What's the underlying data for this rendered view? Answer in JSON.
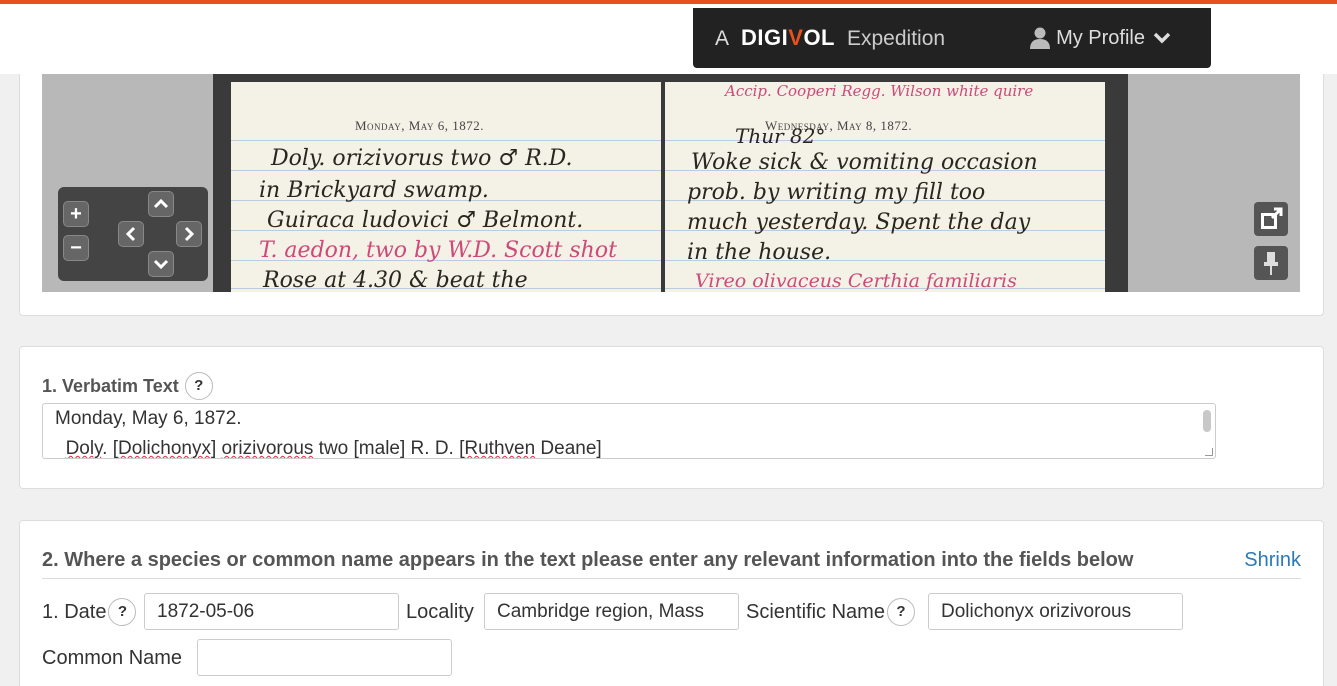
{
  "header": {
    "brand_prefix": "A",
    "brand_logo_a": "DIGI",
    "brand_logo_v": "V",
    "brand_logo_b": "OL",
    "brand_suffix": "Expedition",
    "profile_label": "My Profile"
  },
  "viewer": {
    "left_page_heading": "Monday, May 6, 1872.",
    "right_page_heading": "Wednesday, May 8, 1872.",
    "left_hand_1": "Doly. orizivorus  two ♂ R.D.",
    "left_hand_2": "in Brickyard swamp.",
    "left_hand_3": "Guiraca ludovici ♂ Belmont.",
    "left_hand_4": "T. aedon, two by W.D. Scott shot",
    "left_hand_5": "Rose at 4.30 & beat the",
    "right_hand_0": "Thur 82°",
    "right_hand_1": "Woke sick & vomiting occasion",
    "right_hand_2": "prob. by writing my fill too",
    "right_hand_3": "much yesterday. Spent the day",
    "right_hand_4": "in the house.",
    "right_hand_5": "Vireo olivaceus  Certhia familiaris",
    "right_red_top": "Accip. Cooperi  Regg. Wilson white quire",
    "zoom_in": "+",
    "zoom_out": "−"
  },
  "verbatim": {
    "title": "1. Verbatim Text",
    "help": "?",
    "line1": "Monday, May 6, 1872.",
    "line2_a": "  ",
    "line2_b": "Doly",
    "line2_c": ". [",
    "line2_d": "Dolichonyx",
    "line2_e": "] ",
    "line2_f": "orizivorous",
    "line2_g": " two [male] R. D. [",
    "line2_h": "Ruthven",
    "line2_i": " Deane]"
  },
  "species": {
    "title": "2. Where a species or common name appears in the text please enter any relevant information into the fields below",
    "shrink": "Shrink",
    "date_label": "1. Date",
    "date_help": "?",
    "date_value": "1872-05-06",
    "locality_label": "Locality",
    "locality_value": "Cambridge region, Mass",
    "sci_label": "Scientific Name",
    "sci_help": "?",
    "sci_value": "Dolichonyx orizivorous",
    "common_label": "Common Name",
    "common_value": ""
  },
  "colors": {
    "accent": "#e8501e",
    "link": "#2a7ab8",
    "header_bg": "#222222"
  }
}
